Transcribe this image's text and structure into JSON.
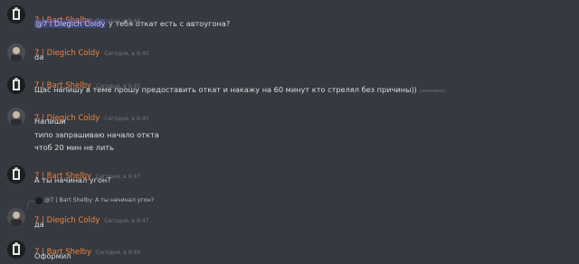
{
  "messages": [
    {
      "author": "7 | Bart Shelby",
      "time": "Сегодня, в 9:44",
      "mention": "@7 l Diegich Coldy",
      "text": " у тебя откат есть с автоугона?"
    },
    {
      "author": "7 | Diegich Coldy",
      "time": "Сегодня, в 9:45",
      "lines": [
        "da"
      ]
    },
    {
      "author": "7 | Bart Shelby",
      "time": "Сегодня, в 9:45",
      "text": "Щас напишу в теме прошу предоставить откат и накажу на 60 минут кто стрелял без причины))",
      "edited": "(изменено)"
    },
    {
      "author": "7 | Diegich Coldy",
      "time": "Сегодня, в 9:45",
      "lines": [
        "Напиши",
        "типо запрашиваю начало откта",
        "чтоб 20 мин не лить"
      ]
    },
    {
      "author": "7 | Bart Shelby",
      "time": "Сегодня, в 9:47",
      "lines": [
        "А ты начинал угон?"
      ]
    },
    {
      "reply_author": "@7 | Bart Shelby",
      "reply_text": "А ты начинал угон?",
      "author": "7 | Diegich Coldy",
      "time": "Сегодня, в 9:47",
      "lines": [
        "да"
      ]
    },
    {
      "author": "7 | Bart Shelby",
      "time": "Сегодня, в 9:49",
      "lines": [
        "Оформил"
      ]
    }
  ]
}
